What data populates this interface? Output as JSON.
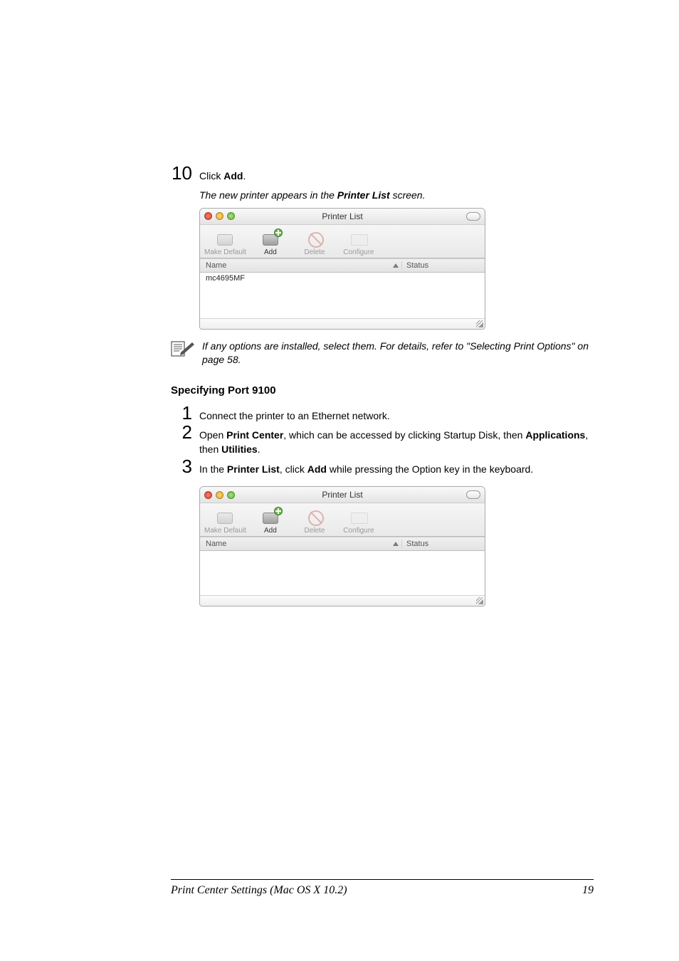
{
  "step10": {
    "number": "10",
    "pretext": "Click ",
    "bold": "Add",
    "posttext": "."
  },
  "caption1": {
    "pre": "The new printer appears in the ",
    "bold": "Printer List",
    "post": " screen."
  },
  "window1": {
    "title": "Printer List",
    "toolbar": {
      "make_default": "Make Default",
      "add": "Add",
      "delete": "Delete",
      "configure": "Configure"
    },
    "columns": {
      "name": "Name",
      "status": "Status"
    },
    "rows": [
      "mc4695MF"
    ]
  },
  "note": {
    "text": "If any options are installed, select them. For details, refer to \"Selecting Print Options\" on page 58."
  },
  "subheading": "Specifying Port 9100",
  "step1": {
    "number": "1",
    "text": "Connect the printer to an Ethernet network."
  },
  "step2": {
    "number": "2",
    "pre": "Open ",
    "bold1": "Print Center",
    "mid": ", which can be accessed by clicking Startup Disk, then ",
    "bold2": "Applications",
    "mid2": ", then ",
    "bold3": "Utilities",
    "post": "."
  },
  "step3": {
    "number": "3",
    "pre": "In the ",
    "bold1": "Printer List",
    "mid": ", click ",
    "bold2": "Add",
    "post": " while pressing the Option key in the keyboard."
  },
  "window2": {
    "title": "Printer List",
    "toolbar": {
      "make_default": "Make Default",
      "add": "Add",
      "delete": "Delete",
      "configure": "Configure"
    },
    "columns": {
      "name": "Name",
      "status": "Status"
    }
  },
  "footer": {
    "section": "Print Center Settings (Mac OS X 10.2)",
    "page": "19"
  }
}
